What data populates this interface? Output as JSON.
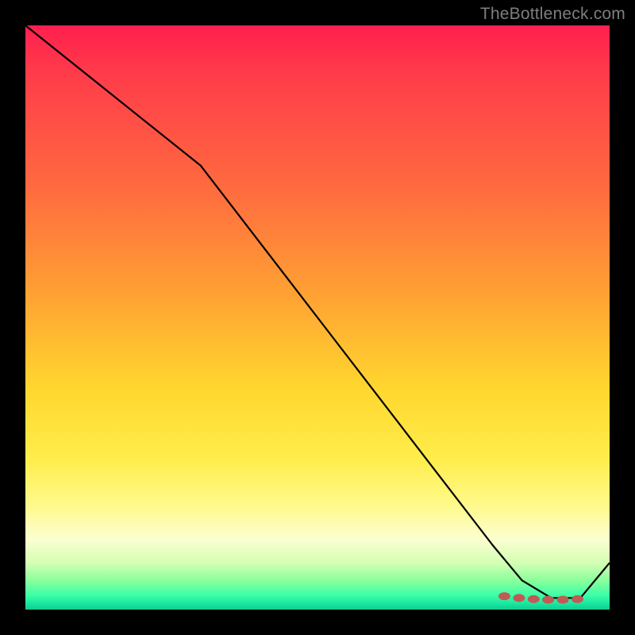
{
  "watermark": "TheBottleneck.com",
  "chart_data": {
    "type": "line",
    "title": "",
    "xlabel": "",
    "ylabel": "",
    "xlim": [
      0,
      100
    ],
    "ylim": [
      0,
      100
    ],
    "grid": false,
    "legend": false,
    "series": [
      {
        "name": "bottleneck-curve",
        "x": [
          0,
          10,
          20,
          30,
          40,
          50,
          60,
          70,
          80,
          85,
          90,
          92,
          95,
          100
        ],
        "values": [
          100,
          92,
          84,
          76,
          63,
          50,
          37,
          24,
          11,
          5,
          2,
          2,
          2,
          8
        ]
      }
    ],
    "markers": {
      "name": "optimal-zone-dots",
      "x": [
        82,
        84.5,
        87,
        89.5,
        92,
        94.5
      ],
      "y": [
        2.3,
        2.0,
        1.8,
        1.7,
        1.7,
        1.8
      ]
    },
    "gradient_stops": [
      {
        "pos": 0.0,
        "color": "#ff1f4f"
      },
      {
        "pos": 0.28,
        "color": "#ff6b3f"
      },
      {
        "pos": 0.62,
        "color": "#ffd62e"
      },
      {
        "pos": 0.88,
        "color": "#fbffd0"
      },
      {
        "pos": 0.97,
        "color": "#3dffa6"
      },
      {
        "pos": 1.0,
        "color": "#12c98e"
      }
    ]
  }
}
